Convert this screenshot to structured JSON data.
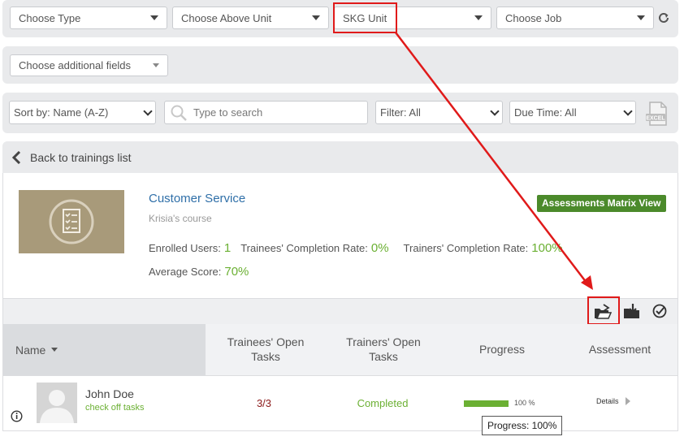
{
  "filters_row1": {
    "type": "Choose Type",
    "above_unit": "Choose Above Unit",
    "unit": "SKG Unit",
    "job": "Choose Job"
  },
  "filters_row2": {
    "additional_fields": "Choose additional fields"
  },
  "search_row": {
    "sort": "Sort by: Name (A-Z)",
    "search_placeholder": "Type to search",
    "filter": "Filter: All",
    "due_time": "Due Time: All"
  },
  "back_link": "Back to trainings list",
  "course": {
    "title": "Customer Service",
    "subtitle": "Krisia's course",
    "matrix_button": "Assessments Matrix View",
    "enrolled_label": "Enrolled Users:",
    "enrolled_value": "1",
    "trainees_rate_label": "Trainees' Completion Rate:",
    "trainees_rate_value": "0%",
    "trainers_rate_label": "Trainers' Completion Rate:",
    "trainers_rate_value": "100%",
    "avg_label": "Average Score:",
    "avg_value": "70%"
  },
  "table": {
    "headers": {
      "name": "Name",
      "trainees_open": "Trainees' Open Tasks",
      "trainers_open": "Trainers' Open Tasks",
      "progress": "Progress",
      "assessment": "Assessment"
    },
    "rows": [
      {
        "name": "John Doe",
        "link": "check off tasks",
        "trainees_open": "3/3",
        "trainers_open": "Completed",
        "progress": 1.0,
        "progress_label": "100 %",
        "assessment": "Details"
      }
    ]
  },
  "tooltip": "Progress: 100%",
  "colors": {
    "accent_green": "#6bb033",
    "button_green": "#4b8a2b",
    "highlight_red": "#e01a1a",
    "task_red": "#8b1a1a"
  }
}
